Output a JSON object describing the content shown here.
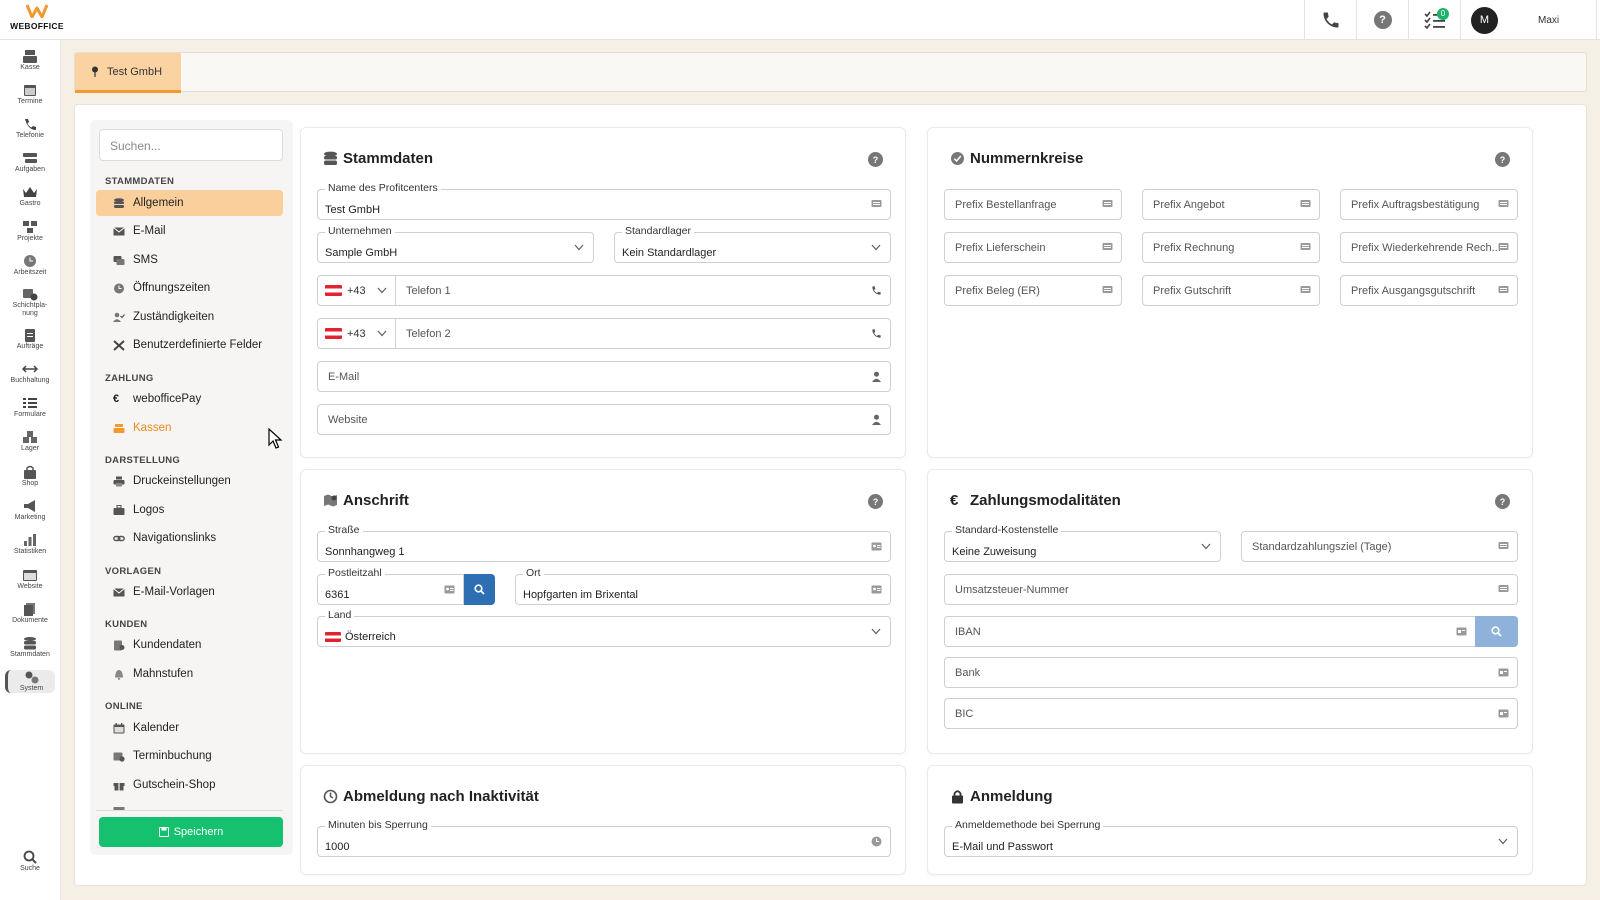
{
  "app": {
    "logo_text": "WEBOFFICE",
    "user_initial": "M",
    "user_name": "Maxi",
    "tasks_badge": "0"
  },
  "rail": [
    {
      "label": "Kasse",
      "icon": "cash-register-icon"
    },
    {
      "label": "Termine",
      "icon": "calendar-icon"
    },
    {
      "label": "Telefonie",
      "icon": "phone-icon"
    },
    {
      "label": "Aufgaben",
      "icon": "tasks-icon"
    },
    {
      "label": "Gastro",
      "icon": "crown-icon"
    },
    {
      "label": "Projekte",
      "icon": "projects-icon"
    },
    {
      "label": "Arbeitszeit",
      "icon": "clock-icon"
    },
    {
      "label": "Schichtpla-\nnung",
      "icon": "shift-icon"
    },
    {
      "label": "Aufträge",
      "icon": "orders-icon"
    },
    {
      "label": "Buchhaltung",
      "icon": "arrows-icon"
    },
    {
      "label": "Formulare",
      "icon": "list-icon"
    },
    {
      "label": "Lager",
      "icon": "boxes-icon"
    },
    {
      "label": "Shop",
      "icon": "bag-icon"
    },
    {
      "label": "Marketing",
      "icon": "megaphone-icon"
    },
    {
      "label": "Statistiken",
      "icon": "chart-icon"
    },
    {
      "label": "Website",
      "icon": "browser-icon"
    },
    {
      "label": "Dokumente",
      "icon": "documents-icon"
    },
    {
      "label": "Stammdaten",
      "icon": "database-icon"
    },
    {
      "label": "System",
      "icon": "gears-icon"
    }
  ],
  "rail_search_label": "Suche",
  "tab": {
    "label": "Test GmbH"
  },
  "nav": {
    "search_placeholder": "Suchen...",
    "sections": {
      "stammdaten": "STAMMDATEN",
      "zahlung": "ZAHLUNG",
      "darstellung": "DARSTELLUNG",
      "vorlagen": "VORLAGEN",
      "kunden": "KUNDEN",
      "online": "ONLINE"
    },
    "items": {
      "allgemein": "Allgemein",
      "email": "E-Mail",
      "sms": "SMS",
      "oeffnungszeiten": "Öffnungszeiten",
      "zustaendigkeiten": "Zuständigkeiten",
      "benutzerfelder": "Benutzerdefinierte Felder",
      "weboffice_pay": "webofficePay",
      "kassen": "Kassen",
      "druck": "Druckeinstellungen",
      "logos": "Logos",
      "navlinks": "Navigationslinks",
      "email_vorlagen": "E-Mail-Vorlagen",
      "kundendaten": "Kundendaten",
      "mahnstufen": "Mahnstufen",
      "kalender": "Kalender",
      "terminbuchung": "Terminbuchung",
      "gutschein_shop": "Gutschein-Shop"
    },
    "save_label": "Speichern"
  },
  "stammdaten": {
    "title": "Stammdaten",
    "profitcenter_label": "Name des Profitcenters",
    "profitcenter_value": "Test GmbH",
    "unternehmen_label": "Unternehmen",
    "unternehmen_value": "Sample GmbH",
    "lager_label": "Standardlager",
    "lager_value": "Kein Standardlager",
    "phone1_cc": "+43",
    "phone1_placeholder": "Telefon 1",
    "phone2_cc": "+43",
    "phone2_placeholder": "Telefon 2",
    "email_placeholder": "E-Mail",
    "website_placeholder": "Website"
  },
  "nummernkreise": {
    "title": "Nummernkreise",
    "fields": [
      "Prefix Bestellanfrage",
      "Prefix Angebot",
      "Prefix Auftragsbestätigung",
      "Prefix Lieferschein",
      "Prefix Rechnung",
      "Prefix Wiederkehrende Rech...",
      "Prefix Beleg (ER)",
      "Prefix Gutschrift",
      "Prefix Ausgangsgutschrift"
    ]
  },
  "anschrift": {
    "title": "Anschrift",
    "strasse_label": "Straße",
    "strasse_value": "Sonnhangweg 1",
    "plz_label": "Postleitzahl",
    "plz_value": "6361",
    "ort_label": "Ort",
    "ort_value": "Hopfgarten im Brixental",
    "land_label": "Land",
    "land_value": "Österreich"
  },
  "zahlungsmodalitaeten": {
    "title": "Zahlungsmodalitäten",
    "kostenstelle_label": "Standard-Kostenstelle",
    "kostenstelle_value": "Keine Zuweisung",
    "zahlungsziel_placeholder": "Standardzahlungsziel (Tage)",
    "ust_placeholder": "Umsatzsteuer-Nummer",
    "iban_placeholder": "IBAN",
    "bank_placeholder": "Bank",
    "bic_placeholder": "BIC"
  },
  "abmeldung": {
    "title": "Abmeldung nach Inaktivität",
    "minuten_label": "Minuten bis Sperrung",
    "minuten_value": "1000"
  },
  "anmeldung": {
    "title": "Anmeldung",
    "methode_label": "Anmeldemethode bei Sperrung",
    "methode_value": "E-Mail und Passwort"
  },
  "colors": {
    "accent": "#f29a2e",
    "tab_bg": "#fbd3a3",
    "save": "#15c06f",
    "search_btn": "#2d6fb2"
  }
}
